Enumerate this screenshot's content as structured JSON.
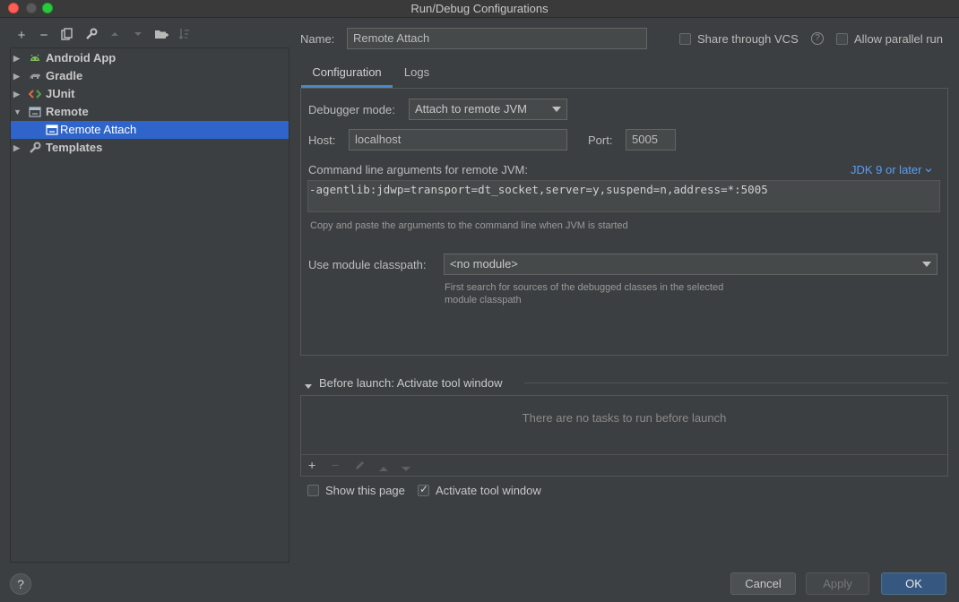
{
  "window": {
    "title": "Run/Debug Configurations"
  },
  "toolbar": {
    "icons": [
      "add-icon",
      "remove-icon",
      "copy-icon",
      "wrench-icon",
      "move-up-icon",
      "move-down-icon",
      "new-folder-icon",
      "sort-icon"
    ],
    "add": "+",
    "remove": "−"
  },
  "tree": {
    "items": [
      {
        "label": "Android App",
        "icon": "android-icon"
      },
      {
        "label": "Gradle",
        "icon": "gradle-icon"
      },
      {
        "label": "JUnit",
        "icon": "junit-icon"
      },
      {
        "label": "Remote",
        "icon": "remote-icon"
      },
      {
        "label": "Remote Attach",
        "icon": "remote-config-icon"
      },
      {
        "label": "Templates",
        "icon": "wrench-icon"
      }
    ]
  },
  "form": {
    "name_label": "Name:",
    "name_value": "Remote Attach",
    "share_vcs_label": "Share through VCS",
    "allow_parallel_label": "Allow parallel run",
    "tabs": [
      {
        "label": "Configuration"
      },
      {
        "label": "Logs"
      }
    ],
    "debugger_mode_label": "Debugger mode:",
    "debugger_mode_value": "Attach to remote JVM",
    "host_label": "Host:",
    "host_value": "localhost",
    "port_label": "Port:",
    "port_value": "5005",
    "cmd_label": "Command line arguments for remote JVM:",
    "jdk_link": "JDK 9 or later",
    "cmd_value": "-agentlib:jdwp=transport=dt_socket,server=y,suspend=n,address=*:5005",
    "cmd_hint": "Copy and paste the arguments to the command line when JVM is started",
    "module_label": "Use module classpath:",
    "module_value": "<no module>",
    "module_hint_1": "First search for sources of the debugged classes in the selected",
    "module_hint_2": "module classpath"
  },
  "before_launch": {
    "title": "Before launch: Activate tool window",
    "empty_text": "There are no tasks to run before launch",
    "add": "+",
    "remove": "−"
  },
  "footer": {
    "show_page_label": "Show this page",
    "activate_tool_label": "Activate tool window",
    "help": "?",
    "cancel": "Cancel",
    "apply": "Apply",
    "ok": "OK"
  },
  "colors": {
    "background": "#3c3f41",
    "selection": "#2f65ca",
    "link": "#589df6",
    "primary_button": "#365880"
  }
}
